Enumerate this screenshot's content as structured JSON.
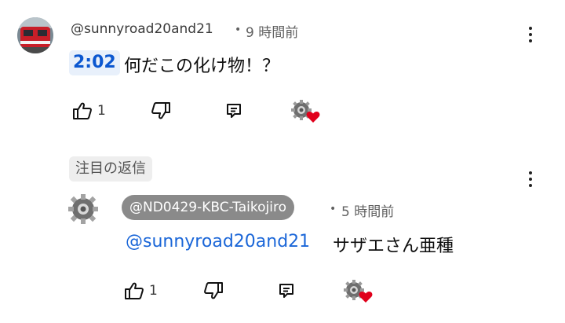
{
  "comment": {
    "author": "@sunnyroad20and21",
    "separator": "•",
    "time": "9 時間前",
    "timestamp": "2:02",
    "text": "何だこの化け物！？",
    "like_count": "1"
  },
  "replies_header": {
    "label": "注目の返信"
  },
  "reply": {
    "author": "@ND0429-KBC-Taikojiro",
    "separator": "•",
    "time": "5 時間前",
    "mention": "@sunnyroad20and21",
    "text": "サザエさん亜種",
    "like_count": "1"
  },
  "icons": {
    "like": "thumbs-up-icon",
    "dislike": "thumbs-down-icon",
    "reply": "reply-icon",
    "more": "more-vert-icon",
    "heart": "heart-icon"
  },
  "colors": {
    "link_blue": "#0b57d0",
    "mention_blue": "#1a66d8",
    "heart_red": "#e0001b",
    "chip_gray": "#8a8a8a"
  }
}
